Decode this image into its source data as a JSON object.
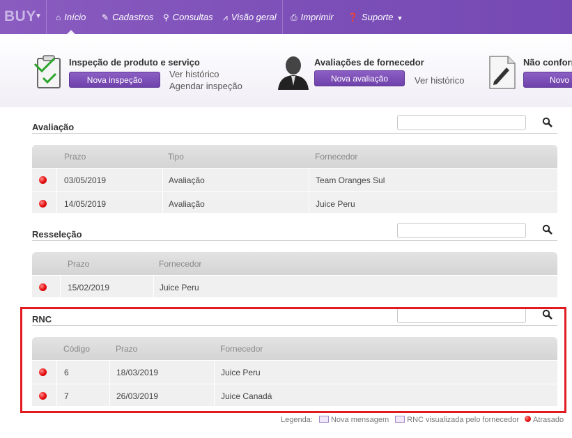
{
  "nav": {
    "brand": "BUY",
    "items": [
      {
        "label": "Início",
        "icon": "home-icon"
      },
      {
        "label": "Cadastros",
        "icon": "pencil-icon"
      },
      {
        "label": "Consultas",
        "icon": "search-icon"
      },
      {
        "label": "Visão geral",
        "icon": "chart-icon"
      },
      {
        "label": "Imprimir",
        "icon": "printer-icon"
      },
      {
        "label": "Suporte",
        "icon": "question-icon"
      }
    ]
  },
  "shortcuts": {
    "inspection": {
      "title": "Inspeção de produto e serviço",
      "button": "Nova inspeção",
      "link1": "Ver histórico",
      "link2": "Agendar inspeção"
    },
    "evaluation": {
      "title": "Avaliações de fornecedor",
      "button": "Nova avaliação",
      "link1": "Ver histórico"
    },
    "nonconformity": {
      "title": "Não conform",
      "button": "Novo"
    }
  },
  "sections": {
    "avaliacao": {
      "title": "Avaliação",
      "columns": [
        "Prazo",
        "Tipo",
        "Fornecedor"
      ],
      "rows": [
        {
          "prazo": "03/05/2019",
          "tipo": "Avaliação",
          "fornecedor": "Team Oranges Sul"
        },
        {
          "prazo": "14/05/2019",
          "tipo": "Avaliação",
          "fornecedor": "Juice Peru"
        }
      ]
    },
    "resselecao": {
      "title": "Resseleção",
      "columns": [
        "Prazo",
        "Fornecedor"
      ],
      "rows": [
        {
          "prazo": "15/02/2019",
          "fornecedor": "Juice Peru"
        }
      ]
    },
    "rnc": {
      "title": "RNC",
      "columns": [
        "Código",
        "Prazo",
        "Fornecedor"
      ],
      "rows": [
        {
          "codigo": "6",
          "prazo": "18/03/2019",
          "fornecedor": "Juice Peru"
        },
        {
          "codigo": "7",
          "prazo": "26/03/2019",
          "fornecedor": "Juice Canadá"
        }
      ]
    }
  },
  "legend": {
    "label": "Legenda:",
    "new_message": "Nova mensagem",
    "rnc_viewed": "RNC visualizada pelo fornecedor",
    "late": "Atrasado"
  },
  "colors": {
    "accent": "#7c4fb8",
    "late": "#e50b0b",
    "highlight": "#e01b22"
  }
}
